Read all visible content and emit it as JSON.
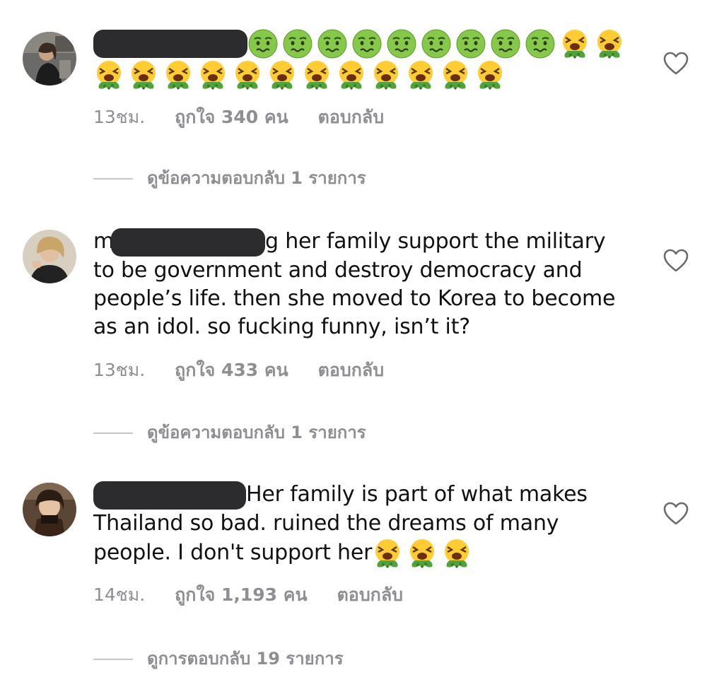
{
  "colors": {
    "redaction": "#2c2c2e",
    "meta": "#8e8e93",
    "sick": "#7fc243",
    "vomit": "#4fa33a"
  },
  "comments": [
    {
      "username": "",
      "text": "",
      "emoji_sick_count": 9,
      "emoji_vomit_count": 14,
      "time": "13ชม.",
      "likes": "ถูกใจ 340 คน",
      "reply_label": "ตอบกลับ",
      "view_replies": "ดูข้อความตอบกลับ 1 รายการ"
    },
    {
      "username_visible": "m",
      "text_first": "g her family support the military",
      "text_rest": "to be government and destroy democracy and people’s life. then she moved to Korea to become as an idol. so fucking funny, isn’t it?",
      "time": "13ชม.",
      "likes": "ถูกใจ 433 คน",
      "reply_label": "ตอบกลับ",
      "view_replies": "ดูข้อความตอบกลับ 1 รายการ"
    },
    {
      "text_first": "Her family is part of what makes",
      "text_rest": "Thailand so bad.  ruined the dreams of many people. I don't support her",
      "emoji_vomit_count": 3,
      "time": "14ชม.",
      "likes": "ถูกใจ 1,193 คน",
      "reply_label": "ตอบกลับ",
      "view_replies": "ดูการตอบกลับ 19 รายการ"
    }
  ]
}
